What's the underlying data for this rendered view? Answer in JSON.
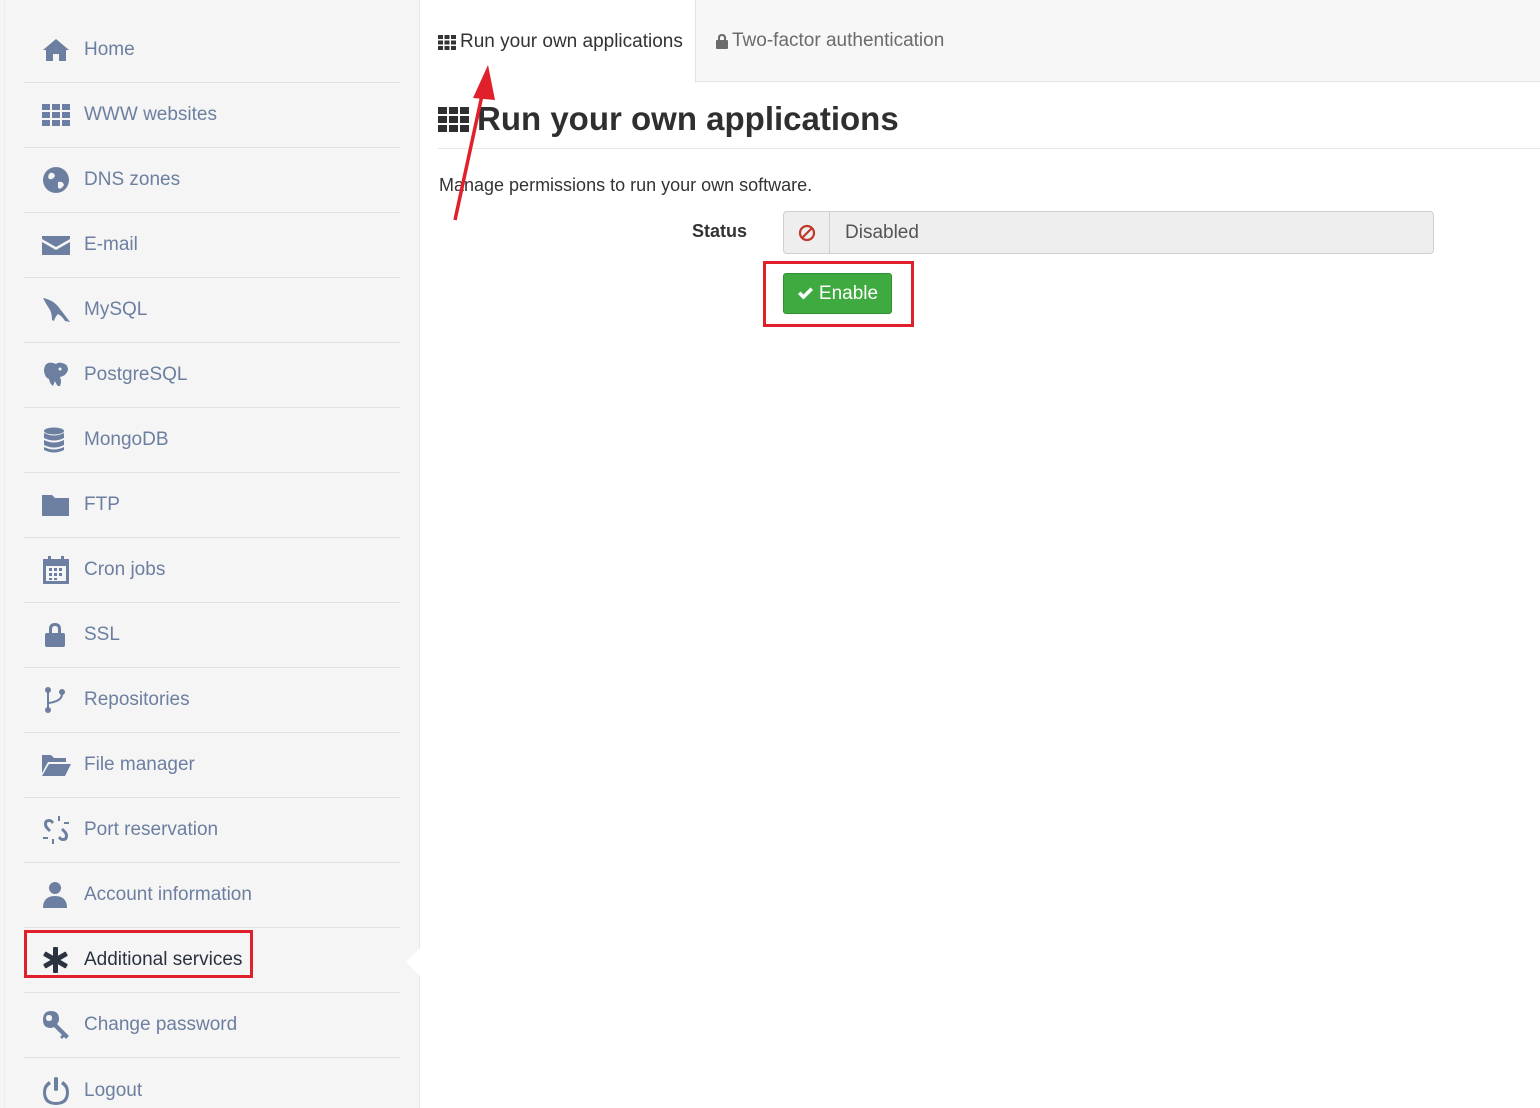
{
  "sidebar": {
    "items": [
      {
        "label": "Home",
        "icon": "home-icon"
      },
      {
        "label": "WWW websites",
        "icon": "grid-icon"
      },
      {
        "label": "DNS zones",
        "icon": "globe-icon"
      },
      {
        "label": "E-mail",
        "icon": "envelope-icon"
      },
      {
        "label": "MySQL",
        "icon": "dolphin-icon"
      },
      {
        "label": "PostgreSQL",
        "icon": "elephant-icon"
      },
      {
        "label": "MongoDB",
        "icon": "database-icon"
      },
      {
        "label": "FTP",
        "icon": "folder-icon"
      },
      {
        "label": "Cron jobs",
        "icon": "calendar-icon"
      },
      {
        "label": "SSL",
        "icon": "lock-icon"
      },
      {
        "label": "Repositories",
        "icon": "branch-icon"
      },
      {
        "label": "File manager",
        "icon": "folder-open-icon"
      },
      {
        "label": "Port reservation",
        "icon": "unlink-icon"
      },
      {
        "label": "Account information",
        "icon": "user-icon"
      },
      {
        "label": "Additional services",
        "icon": "asterisk-icon",
        "active": true
      },
      {
        "label": "Change password",
        "icon": "key-icon"
      },
      {
        "label": "Logout",
        "icon": "power-icon"
      }
    ]
  },
  "tabs": [
    {
      "label": "Run your own applications",
      "icon": "grid-icon",
      "active": true
    },
    {
      "label": "Two-factor authentication",
      "icon": "lock-icon"
    }
  ],
  "main": {
    "title": "Run your own applications",
    "description": "Manage permissions to run your own software.",
    "status_label": "Status",
    "status_value": "Disabled",
    "enable_label": "Enable"
  },
  "colors": {
    "sidebar_text": "#6c7fa0",
    "active_text": "#2b3340",
    "enable_green": "#3faa3f",
    "annotation_red": "#e0202a",
    "disabled_icon": "#c0392b"
  }
}
